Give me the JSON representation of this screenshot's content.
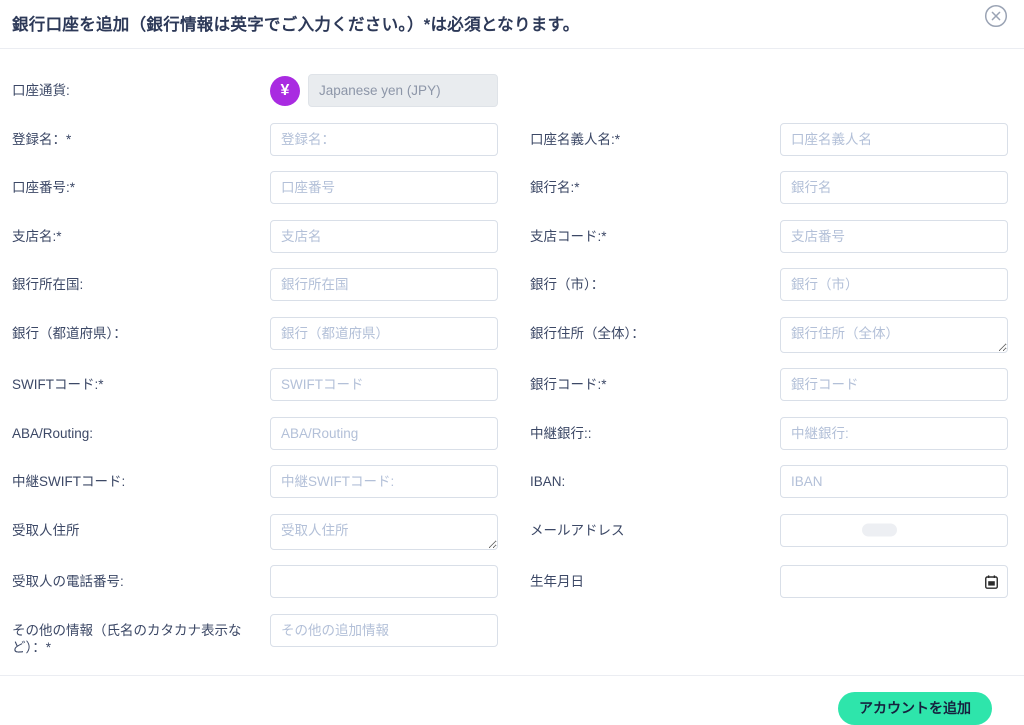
{
  "modal": {
    "title": "銀行口座を追加（銀行情報は英字でご入力ください。）*は必須となります。",
    "close_icon": "circle-x",
    "submit_label": "アカウントを追加"
  },
  "colors": {
    "accent_teal": "#2ee5ab",
    "currency_purple": "#a92be1",
    "title_text": "#2d3958",
    "label_text": "#3c4866",
    "placeholder_text": "#b3c0d8",
    "input_border": "#d9dfe8",
    "disabled_input_bg": "#e9ecef",
    "divider": "#ebedf2"
  },
  "currency": {
    "label": "口座通貨:",
    "icon": "yen-circle-icon",
    "symbol": "¥",
    "value": "Japanese yen (JPY)"
  },
  "rows": [
    {
      "left": {
        "label": "登録名：*",
        "placeholder": "登録名："
      },
      "right": {
        "label": "口座名義人名:*",
        "placeholder": "口座名義人名"
      }
    },
    {
      "left": {
        "label": "口座番号:*",
        "placeholder": "口座番号"
      },
      "right": {
        "label": "銀行名:*",
        "placeholder": "銀行名"
      }
    },
    {
      "left": {
        "label": "支店名:*",
        "placeholder": "支店名"
      },
      "right": {
        "label": "支店コード:*",
        "placeholder": "支店番号"
      }
    },
    {
      "left": {
        "label": "銀行所在国:",
        "placeholder": "銀行所在国"
      },
      "right": {
        "label": "銀行（市）：",
        "placeholder": "銀行（市）"
      }
    },
    {
      "left": {
        "label": "銀行（都道府県）：",
        "placeholder": "銀行（都道府県）"
      },
      "right": {
        "label": "銀行住所（全体）：",
        "placeholder": "銀行住所（全体）"
      }
    },
    {
      "left": {
        "label": "SWIFTコード:*",
        "placeholder": "SWIFTコード"
      },
      "right": {
        "label": "銀行コード:*",
        "placeholder": "銀行コード"
      }
    },
    {
      "left": {
        "label": "ABA/Routing:",
        "placeholder": "ABA/Routing"
      },
      "right": {
        "label": "中継銀行::",
        "placeholder": "中継銀行:"
      }
    },
    {
      "left": {
        "label": "中継SWIFTコード:",
        "placeholder": "中継SWIFTコード:"
      },
      "right": {
        "label": "IBAN:",
        "placeholder": "IBAN"
      }
    },
    {
      "left": {
        "label": "受取人住所",
        "placeholder": "受取人住所"
      },
      "right": {
        "label": "メールアドレス"
      }
    },
    {
      "left": {
        "label": "受取人の電話番号:",
        "placeholder": ""
      },
      "right": {
        "label": "生年月日"
      }
    },
    {
      "left": {
        "label": "その他の情報（氏名のカタカナ表示など）：*",
        "placeholder": "その他の追加情報"
      },
      "right": {
        "label": ""
      }
    }
  ]
}
